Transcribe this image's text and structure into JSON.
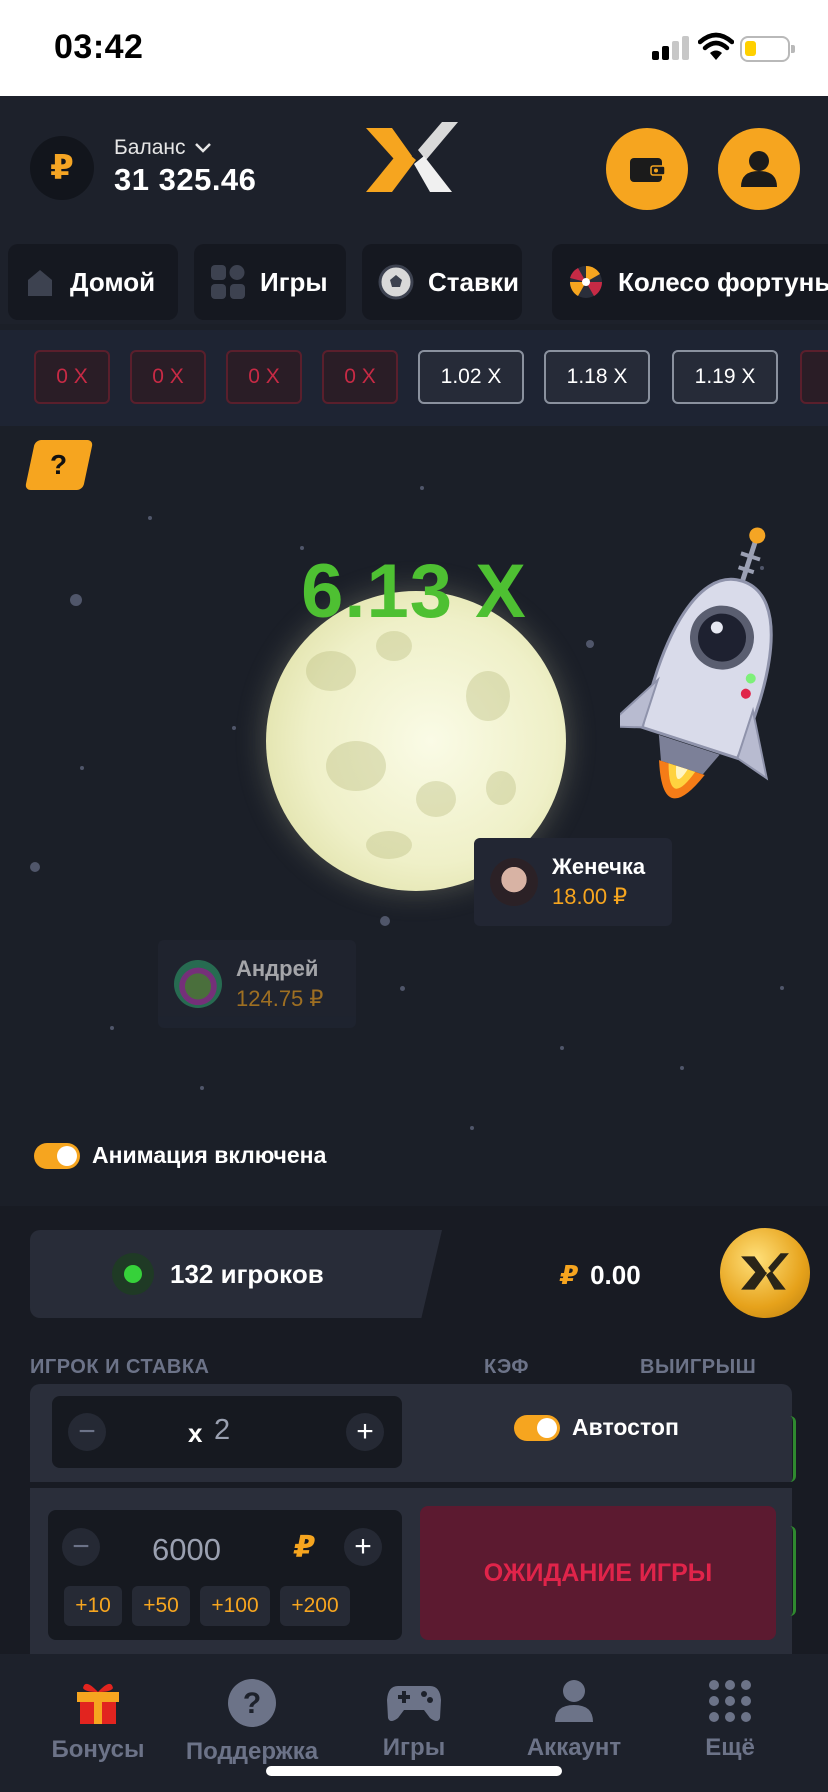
{
  "status_bar": {
    "time": "03:42"
  },
  "header": {
    "balance_label": "Баланс",
    "balance_value": "31 325.46",
    "currency_symbol": "₽"
  },
  "nav_tabs": [
    {
      "label": "Домой",
      "icon": "home-icon"
    },
    {
      "label": "Игры",
      "icon": "games-grid-icon"
    },
    {
      "label": "Ставки",
      "icon": "soccer-ball-icon"
    },
    {
      "label": "Колесо фортуны",
      "icon": "fortune-wheel-icon"
    }
  ],
  "history": [
    "0 X",
    "0 X",
    "0 X",
    "0 X",
    "1.02 X",
    "1.18 X",
    "1.19 X"
  ],
  "game": {
    "help_label": "?",
    "multiplier": "6.13 X",
    "players": [
      {
        "name": "Женечка",
        "win": "18.00 ₽"
      },
      {
        "name": "Андрей",
        "win": "124.75 ₽"
      }
    ],
    "animation_label": "Анимация включена"
  },
  "panel": {
    "players_count": "132 игроков",
    "total_currency": "₽",
    "total_value": "0.00",
    "columns": {
      "player": "ИГРОК И СТАВКА",
      "coef": "КЭФ",
      "win": "ВЫИГРЫШ"
    },
    "autostop_multiplier_prefix": "x",
    "autostop_multiplier": "2",
    "autostop_label": "Автостоп",
    "stake": "6000",
    "stake_currency": "₽",
    "quick_bets": [
      "+10",
      "+50",
      "+100",
      "+200"
    ],
    "wait_button": "ОЖИДАНИЕ ИГРЫ",
    "minus": "−",
    "plus": "+"
  },
  "bottom_nav": [
    {
      "label": "Бонусы",
      "icon": "gift-icon"
    },
    {
      "label": "Поддержка",
      "icon": "help-circle-icon"
    },
    {
      "label": "Игры",
      "icon": "gamepad-icon"
    },
    {
      "label": "Аккаунт",
      "icon": "account-icon"
    },
    {
      "label": "Ещё",
      "icon": "more-dots-icon"
    }
  ],
  "colors": {
    "accent": "#f6a51f",
    "win_green": "#4ec032",
    "lost_red": "#c72a45",
    "bg": "#1b1f28"
  }
}
